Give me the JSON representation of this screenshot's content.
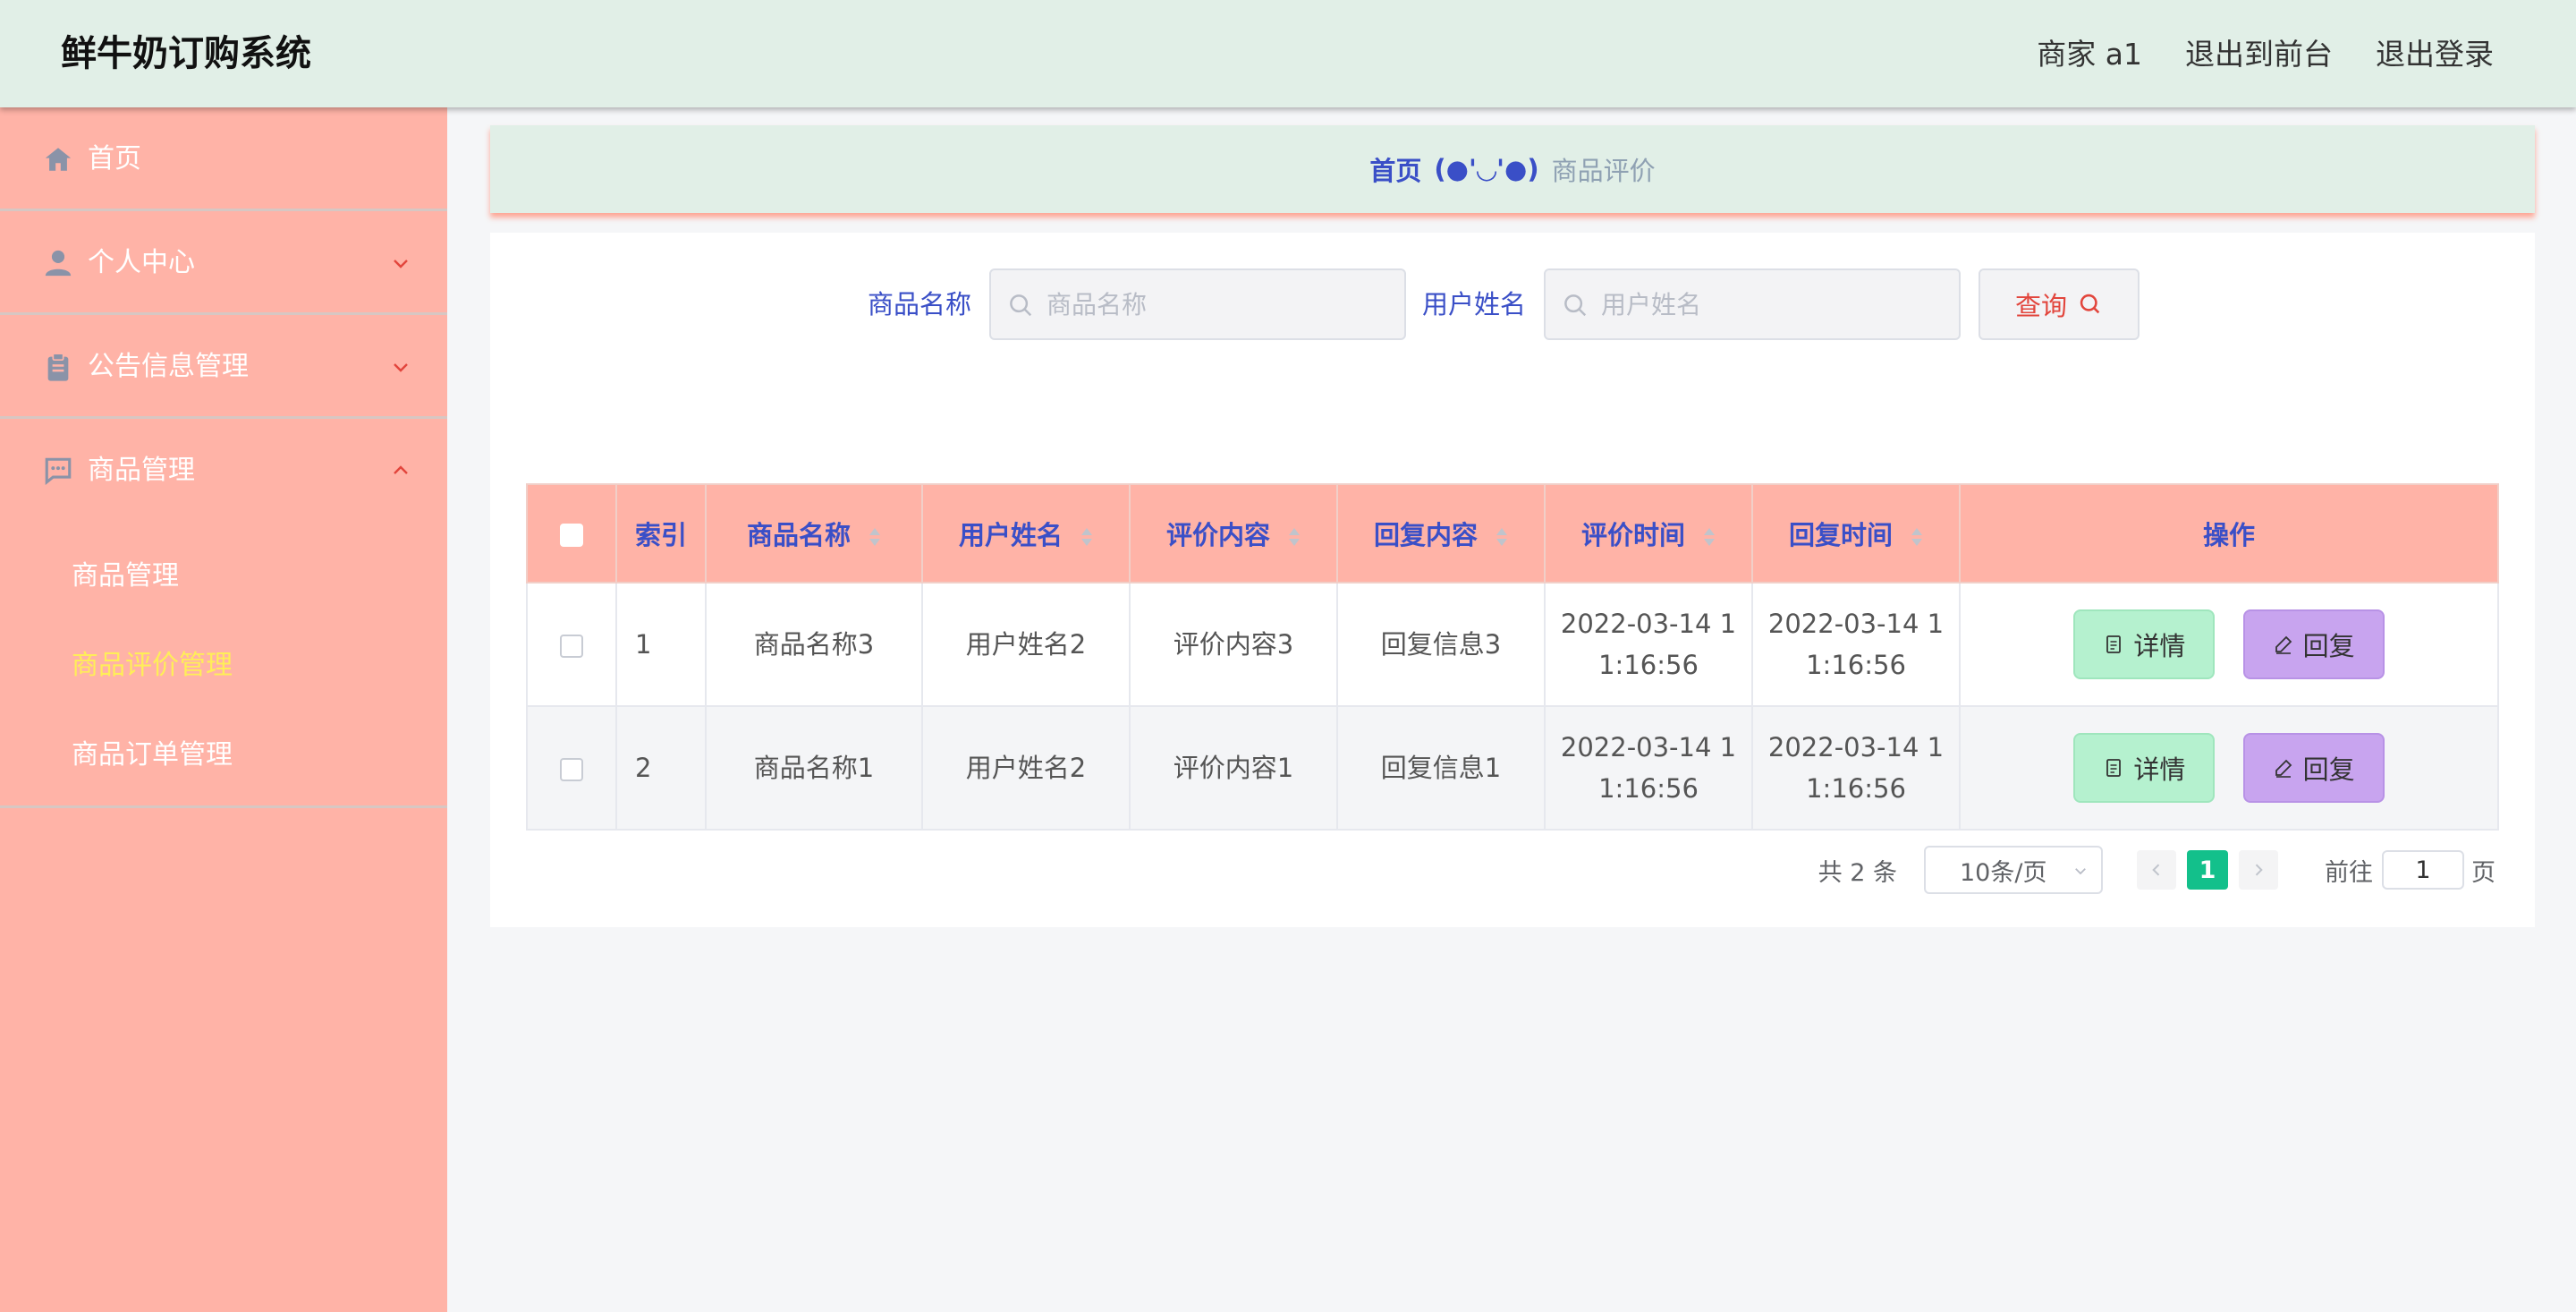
{
  "header": {
    "title": "鲜牛奶订购系统",
    "user_label": "商家 a1",
    "front_link": "退出到前台",
    "logout_link": "退出登录"
  },
  "sidebar": {
    "items": [
      {
        "label": "首页",
        "icon": "home-icon"
      },
      {
        "label": "个人中心",
        "icon": "user-icon"
      },
      {
        "label": "公告信息管理",
        "icon": "clipboard-icon"
      },
      {
        "label": "商品管理",
        "icon": "chat-icon"
      }
    ],
    "subitems": [
      {
        "label": "商品管理",
        "active": false
      },
      {
        "label": "商品评价管理",
        "active": true
      },
      {
        "label": "商品订单管理",
        "active": false
      }
    ]
  },
  "breadcrumb": {
    "home": "首页",
    "separator": "(●'◡'●)",
    "current": "商品评价"
  },
  "search": {
    "product_label": "商品名称",
    "product_placeholder": "商品名称",
    "user_label": "用户姓名",
    "user_placeholder": "用户姓名",
    "query_label": "查询"
  },
  "table": {
    "columns": [
      "索引",
      "商品名称",
      "用户姓名",
      "评价内容",
      "回复内容",
      "评价时间",
      "回复时间",
      "操作"
    ],
    "rows": [
      {
        "index": "1",
        "product": "商品名称3",
        "user": "用户姓名2",
        "review": "评价内容3",
        "reply": "回复信息3",
        "review_time_1": "2022-03-14 1",
        "review_time_2": "1:16:56",
        "reply_time_1": "2022-03-14 1",
        "reply_time_2": "1:16:56"
      },
      {
        "index": "2",
        "product": "商品名称1",
        "user": "用户姓名2",
        "review": "评价内容1",
        "reply": "回复信息1",
        "review_time_1": "2022-03-14 1",
        "review_time_2": "1:16:56",
        "reply_time_1": "2022-03-14 1",
        "reply_time_2": "1:16:56"
      }
    ],
    "detail_label": "详情",
    "reply_label": "回复"
  },
  "pagination": {
    "total": "共 2 条",
    "page_size": "10条/页",
    "current_page": "1",
    "goto_label": "前往",
    "goto_value": "1",
    "page_suffix": "页"
  },
  "colors": {
    "sidebar_bg": "#ffb3a7",
    "header_bg": "#e1efe7",
    "accent_blue": "#3a4fc7",
    "active_menu": "#ffee58",
    "page_active": "#13c08b",
    "detail_btn": "#b5f1cf",
    "reply_btn": "#c8a4ef"
  }
}
